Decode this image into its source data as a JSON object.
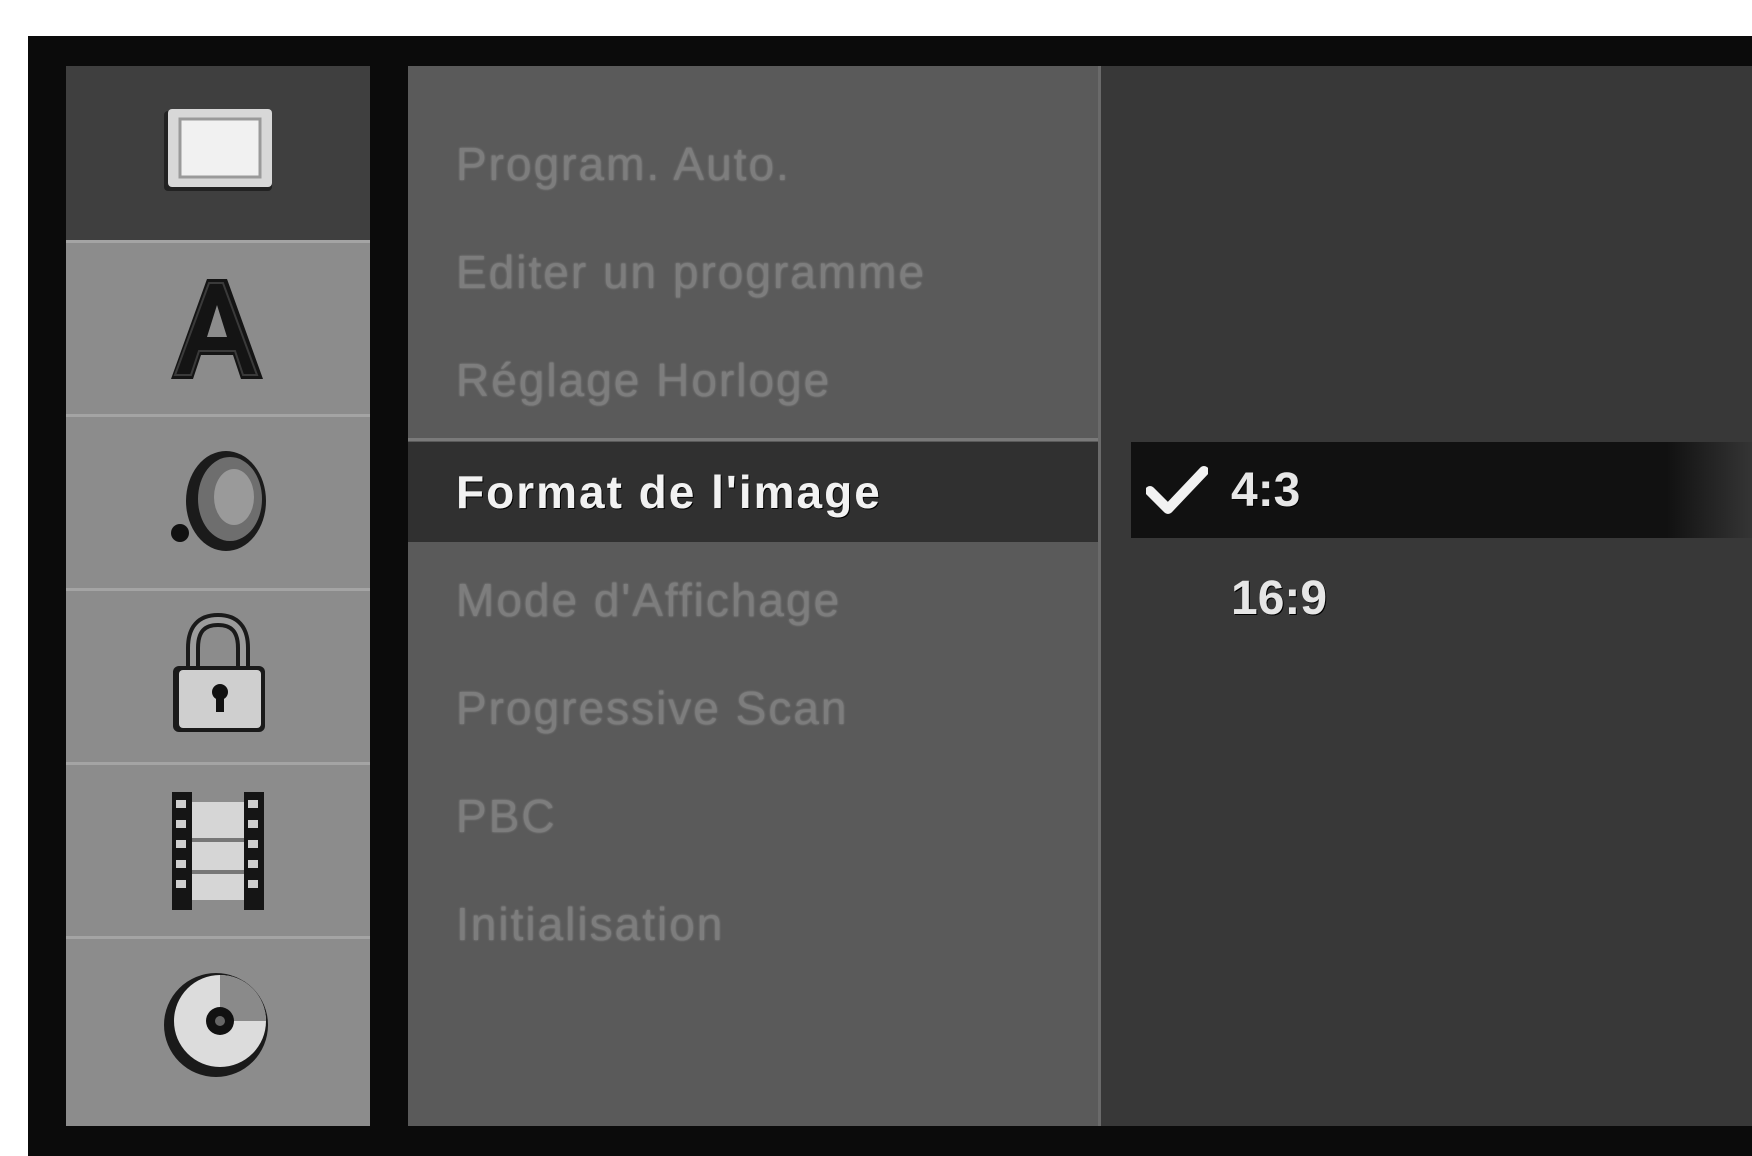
{
  "sidebar": {
    "icons": [
      {
        "name": "screen-icon",
        "active": true
      },
      {
        "name": "language-icon",
        "glyph": "A",
        "active": false
      },
      {
        "name": "speaker-icon",
        "active": false
      },
      {
        "name": "lock-icon",
        "active": false
      },
      {
        "name": "film-icon",
        "active": false
      },
      {
        "name": "disc-icon",
        "active": false
      }
    ]
  },
  "menu": {
    "items": [
      {
        "label": "Program. Auto."
      },
      {
        "label": "Editer un programme"
      },
      {
        "label": "Réglage Horloge"
      },
      {
        "label": "Format de l'image",
        "selected": true
      },
      {
        "label": "Mode d'Affichage"
      },
      {
        "label": "Progressive Scan"
      },
      {
        "label": "PBC"
      },
      {
        "label": "Initialisation"
      }
    ]
  },
  "options": {
    "items": [
      {
        "label": "4:3",
        "checked": true
      },
      {
        "label": "16:9",
        "checked": false
      }
    ]
  },
  "colors": {
    "frame": "#0b0b0b",
    "sidebar": "#8c8c8c",
    "menu_bg": "#5a5a5a",
    "options_bg": "#383838",
    "selected_bg": "#111111"
  }
}
